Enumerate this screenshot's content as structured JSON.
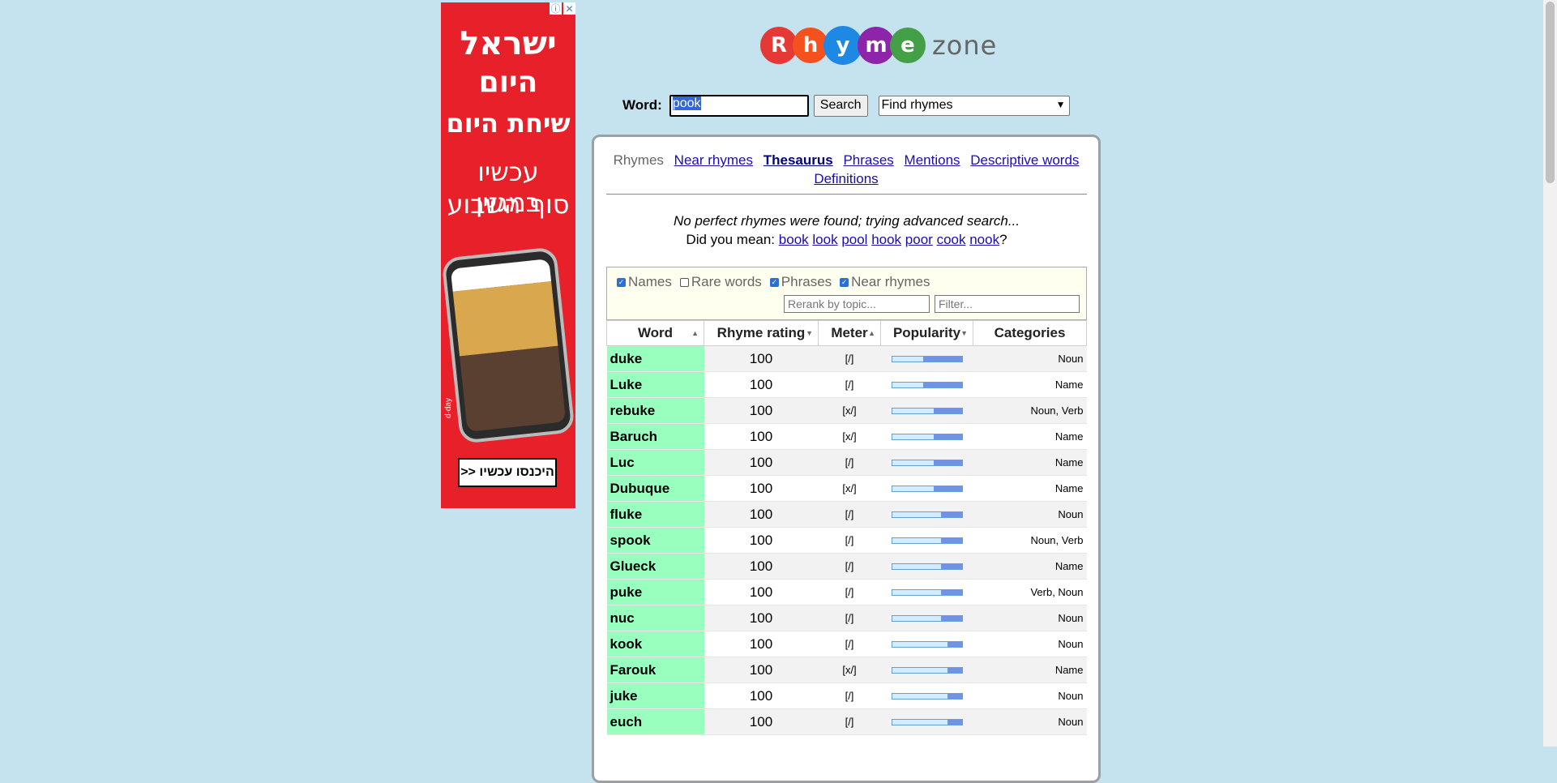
{
  "ad": {
    "close_glyph": "✕",
    "info_glyph": "ⓘ",
    "line1": "ישראל",
    "line2": "היום",
    "line3": "שיחת היום",
    "line4": "עכשיו במגזין",
    "line5": "סוף השבוע",
    "brand": "d·day",
    "cta": "היכנסו עכשיו <<",
    "bg_color": "#e8202a"
  },
  "logo": {
    "letters": [
      {
        "ch": "R",
        "color": "#e53935"
      },
      {
        "ch": "h",
        "color": "#f4511e"
      },
      {
        "ch": "y",
        "color": "#1e88e5"
      },
      {
        "ch": "m",
        "color": "#8e24aa"
      },
      {
        "ch": "e",
        "color": "#43a047"
      }
    ],
    "zone": "zone"
  },
  "search": {
    "label": "Word:",
    "value": "pook",
    "button": "Search",
    "mode": "Find rhymes"
  },
  "tabs": {
    "rhymes": "Rhymes",
    "near": "Near rhymes",
    "thesaurus": "Thesaurus",
    "phrases": "Phrases",
    "mentions": "Mentions",
    "descriptive": "Descriptive words",
    "definitions": "Definitions"
  },
  "message": {
    "notice": "No perfect rhymes were found; trying advanced search...",
    "did_you_mean": "Did you mean:",
    "suggestions": [
      "book",
      "look",
      "pool",
      "hook",
      "poor",
      "cook",
      "nook"
    ],
    "end": "?"
  },
  "filters": {
    "names": {
      "label": "Names",
      "checked": true
    },
    "rare": {
      "label": "Rare words",
      "checked": false
    },
    "phrases": {
      "label": "Phrases",
      "checked": true
    },
    "near": {
      "label": "Near rhymes",
      "checked": true
    },
    "rerank_placeholder": "Rerank by topic...",
    "filter_placeholder": "Filter..."
  },
  "table": {
    "headers": {
      "word": "Word",
      "rating": "Rhyme rating",
      "meter": "Meter",
      "popularity": "Popularity",
      "categories": "Categories"
    },
    "rows": [
      {
        "word": "duke",
        "rating": "100",
        "meter": "[/]",
        "popularity": 0.55,
        "categories": "Noun"
      },
      {
        "word": "Luke",
        "rating": "100",
        "meter": "[/]",
        "popularity": 0.55,
        "categories": "Name"
      },
      {
        "word": "rebuke",
        "rating": "100",
        "meter": "[x/]",
        "popularity": 0.4,
        "categories": "Noun, Verb"
      },
      {
        "word": "Baruch",
        "rating": "100",
        "meter": "[x/]",
        "popularity": 0.4,
        "categories": "Name"
      },
      {
        "word": "Luc",
        "rating": "100",
        "meter": "[/]",
        "popularity": 0.4,
        "categories": "Name"
      },
      {
        "word": "Dubuque",
        "rating": "100",
        "meter": "[x/]",
        "popularity": 0.4,
        "categories": "Name"
      },
      {
        "word": "fluke",
        "rating": "100",
        "meter": "[/]",
        "popularity": 0.3,
        "categories": "Noun"
      },
      {
        "word": "spook",
        "rating": "100",
        "meter": "[/]",
        "popularity": 0.3,
        "categories": "Noun, Verb"
      },
      {
        "word": "Glueck",
        "rating": "100",
        "meter": "[/]",
        "popularity": 0.3,
        "categories": "Name"
      },
      {
        "word": "puke",
        "rating": "100",
        "meter": "[/]",
        "popularity": 0.3,
        "categories": "Verb, Noun"
      },
      {
        "word": "nuc",
        "rating": "100",
        "meter": "[/]",
        "popularity": 0.3,
        "categories": "Noun"
      },
      {
        "word": "kook",
        "rating": "100",
        "meter": "[/]",
        "popularity": 0.2,
        "categories": "Noun"
      },
      {
        "word": "Farouk",
        "rating": "100",
        "meter": "[x/]",
        "popularity": 0.2,
        "categories": "Name"
      },
      {
        "word": "juke",
        "rating": "100",
        "meter": "[/]",
        "popularity": 0.2,
        "categories": "Noun"
      },
      {
        "word": "euch",
        "rating": "100",
        "meter": "[/]",
        "popularity": 0.2,
        "categories": "Noun"
      }
    ]
  }
}
